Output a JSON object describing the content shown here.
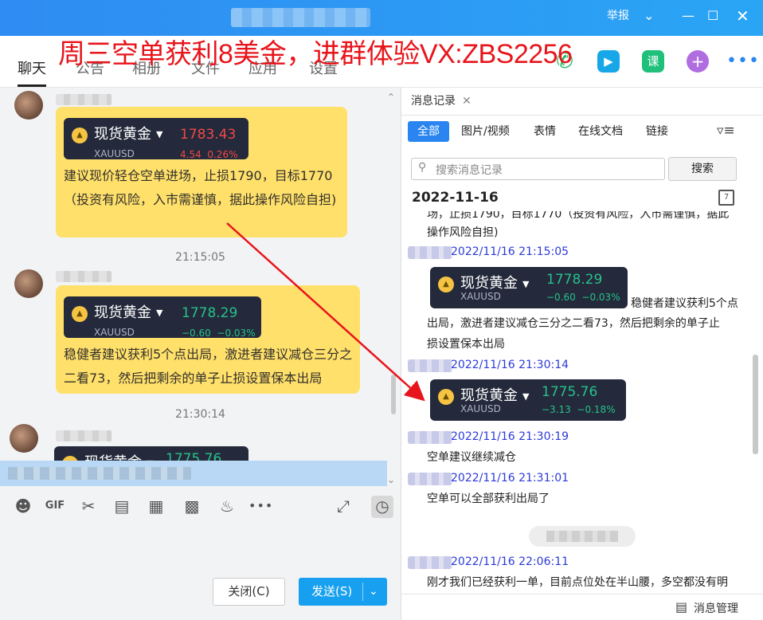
{
  "window": {
    "report_label": "举报",
    "min_icon": "minimize-icon",
    "max_icon": "maximize-icon",
    "close_icon": "close-icon"
  },
  "overlay_text": "周三空单获利8美金，进群体验VX:ZBS2256",
  "tabs": [
    "聊天",
    "公告",
    "相册",
    "文件",
    "应用",
    "设置"
  ],
  "chat": {
    "messages": [
      {
        "card": {
          "name": "现货黄金",
          "symbol": "XAUUSD",
          "price": "1783.43",
          "change": "4.54",
          "percent": "0.26%"
        },
        "text": "建议现价轻仓空单进场，止损1790，目标1770（投资有风险，入市需谨慎，据此操作风险自担)"
      },
      {
        "time": "21:15:05",
        "card": {
          "name": "现货黄金",
          "symbol": "XAUUSD",
          "price": "1778.29",
          "change": "−0.60",
          "percent": "−0.03%"
        },
        "text": "稳健者建议获利5个点出局，激进者建议减仓三分之二看73，然后把剩余的单子止损设置保本出局"
      },
      {
        "time": "21:30:14",
        "card": {
          "name": "现货黄金",
          "price": "1775.76"
        }
      }
    ]
  },
  "toolbar_icons": [
    "emoji-icon",
    "gif-icon",
    "scissors-icon",
    "folder-icon",
    "shake-icon",
    "image-icon",
    "bell-icon",
    "more-icon",
    "expand-icon",
    "clock-icon"
  ],
  "buttons": {
    "close": "关闭(C)",
    "send": "发送(S)"
  },
  "history": {
    "tab_title": "消息记录",
    "filters": [
      "全部",
      "图片/视频",
      "表情",
      "在线文档",
      "链接"
    ],
    "search_placeholder": "搜索消息记录",
    "search_button": "搜索",
    "date": "2022-11-16",
    "calendar_day": "7",
    "partial_text": "场，止损1790，目标1770（投资有风险，入市需谨慎，据此",
    "partial_text2": "操作风险自担)",
    "entries": [
      {
        "time": "2022/11/16 21:15:05"
      },
      {
        "time": "2022/11/16 21:30:14"
      },
      {
        "time": "2022/11/16 21:30:19",
        "text": "空单建议继续减仓"
      },
      {
        "time": "2022/11/16 21:31:01",
        "text": "空单可以全部获利出局了"
      },
      {
        "time": "2022/11/16 22:06:11",
        "text": "刚才我们已经获利一单，目前点位处在半山腰，多空都没有明"
      }
    ],
    "card1": {
      "name": "现货黄金",
      "symbol": "XAUUSD",
      "price": "1778.29",
      "change": "−0.60",
      "percent": "−0.03%"
    },
    "card1_text_a": "稳健者建议获利5个点",
    "card1_text_b": "出局，激进者建议减仓三分之二看73，然后把剩余的单子止",
    "card1_text_c": "损设置保本出局",
    "card2": {
      "name": "现货黄金",
      "symbol": "XAUUSD",
      "price": "1775.76",
      "change": "−3.13",
      "percent": "−0.18%"
    },
    "manage_label": "消息管理"
  }
}
